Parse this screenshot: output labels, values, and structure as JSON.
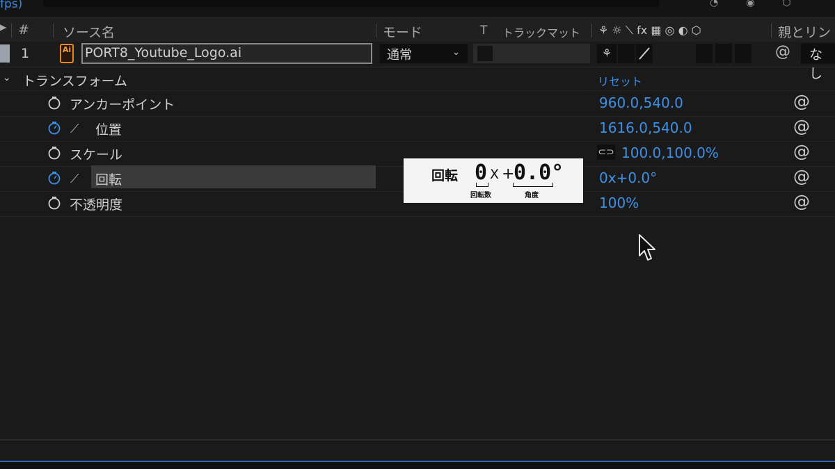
{
  "top": {
    "fps_text": "fps)"
  },
  "columns": {
    "number": "#",
    "source_name": "ソース名",
    "mode": "モード",
    "t": "T",
    "track_matte": "トラックマット",
    "switches": "⚘ ☼ ⟍ fx ▦ ◎ ◐ ⬡",
    "parent": "親とリン"
  },
  "layer": {
    "number": "1",
    "type_icon": "Ai",
    "name": "PORT8_Youtube_Logo.ai",
    "mode": "通常",
    "parent": "なし"
  },
  "transform": {
    "group_label": "トランスフォーム",
    "reset_label": "リセット",
    "properties": [
      {
        "label": "アンカーポイント",
        "value": "960.0,540.0"
      },
      {
        "label": "位置",
        "value": "1616.0,540.0"
      },
      {
        "label": "スケール",
        "value": "100.0,100.0%"
      },
      {
        "label": "回転",
        "value": "0x+0.0°"
      },
      {
        "label": "不透明度",
        "value": "100%"
      }
    ]
  },
  "tooltip": {
    "title": "回転",
    "revolutions": "0",
    "x": "X",
    "plus": "+",
    "degrees": "0.0°",
    "revolutions_caption": "回転数",
    "degrees_caption": "角度"
  },
  "colors": {
    "accent": "#3d90e6",
    "background": "#1a1a1a",
    "ai_orange": "#e08a2a"
  }
}
